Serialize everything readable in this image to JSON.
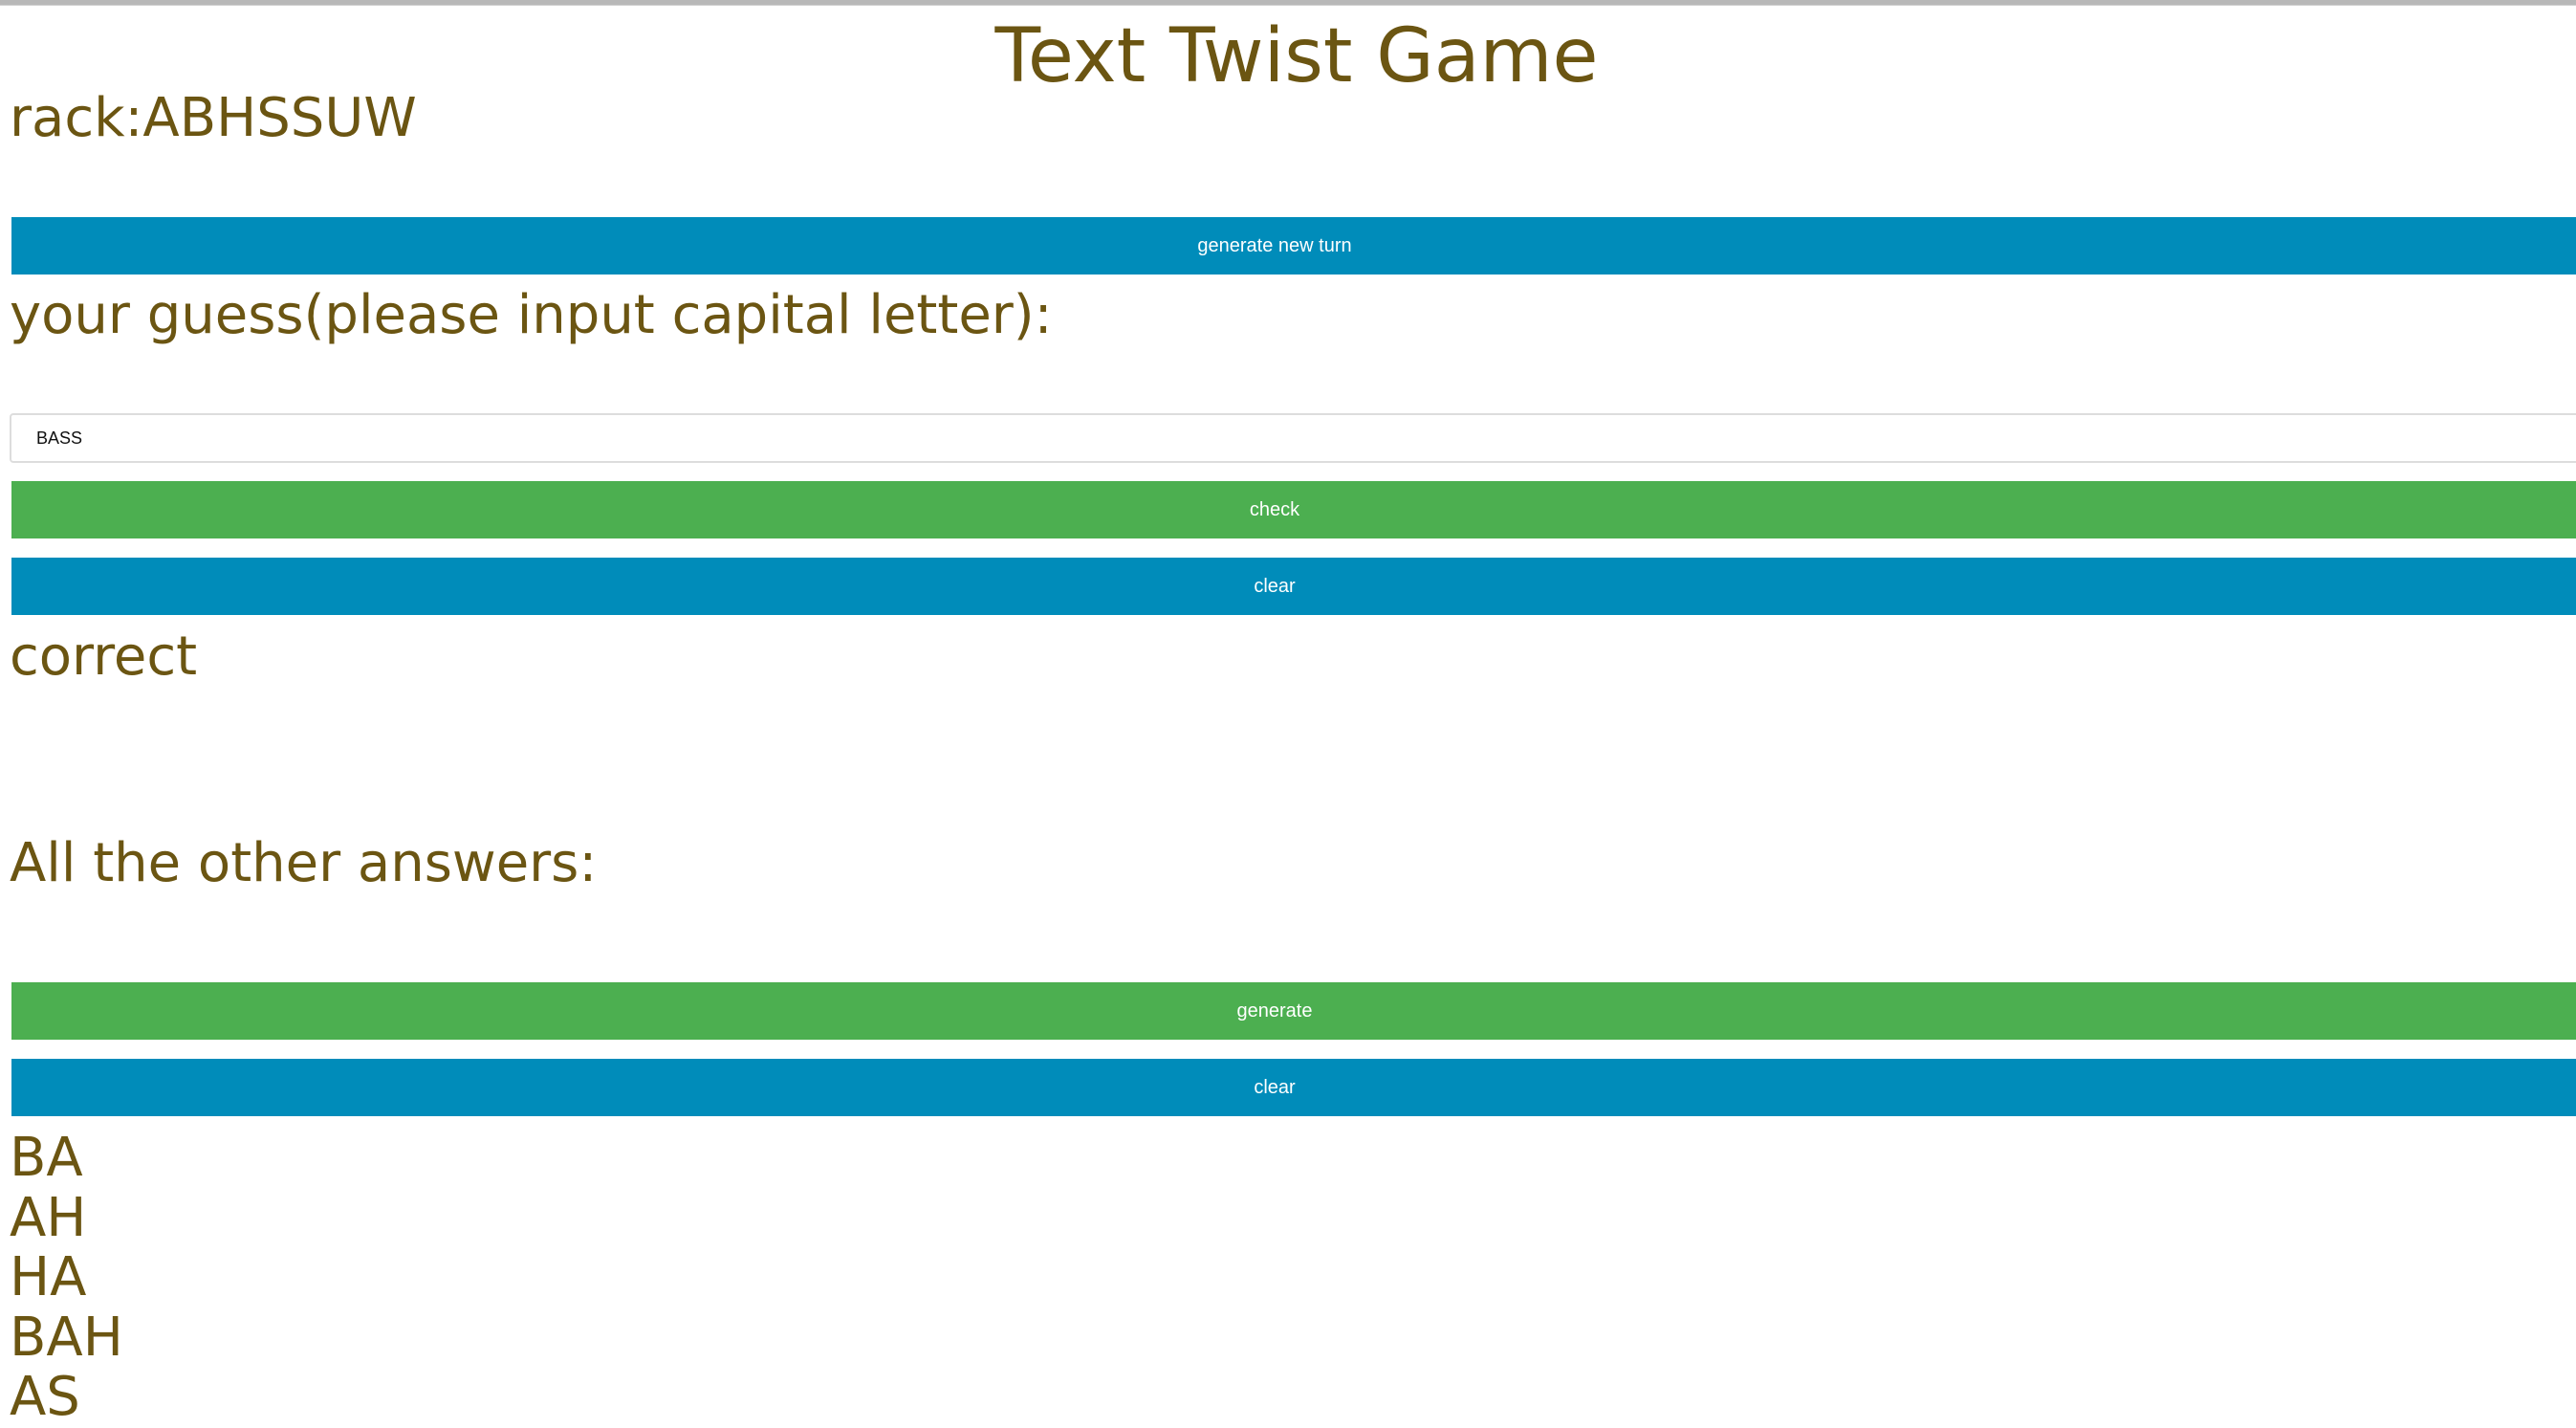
{
  "header": {
    "title": "Text Twist Game"
  },
  "rack": {
    "text": "rack:ABHSSUW"
  },
  "buttons": {
    "new_turn": "generate new turn",
    "check": "check",
    "clear_guess": "clear",
    "generate": "generate",
    "clear_answers": "clear"
  },
  "guess": {
    "label": "your guess(please input capital letter):",
    "value": "BASS",
    "result": "correct"
  },
  "answers": {
    "label": "All the other answers:",
    "items": [
      "BA",
      "AH",
      "HA",
      "BAH",
      "AS"
    ]
  },
  "colors": {
    "text": "#6b5512",
    "blue_button": "#008cba",
    "green_button": "#4caf50"
  }
}
